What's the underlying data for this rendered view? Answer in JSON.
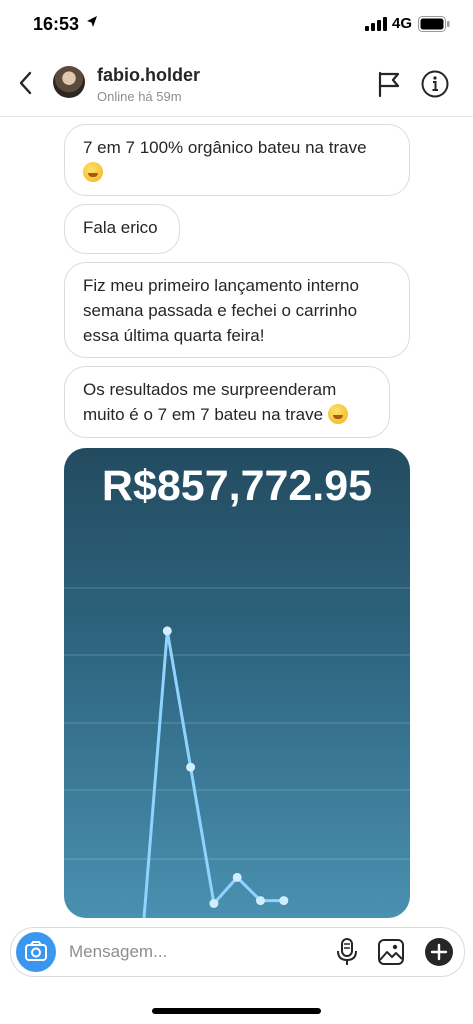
{
  "status_bar": {
    "time": "16:53",
    "network": "4G"
  },
  "header": {
    "username": "fabio.holder",
    "status": "Online há 59m"
  },
  "messages": [
    {
      "text": "7 em 7 100% orgânico bateu na trave"
    },
    {
      "text": "Fala erico"
    },
    {
      "text": "Fiz meu primeiro lançamento interno semana passada e fechei o carrinho essa última quarta feira!"
    },
    {
      "text": "Os resultados me surpreenderam muito é o 7 em 7 bateu na trave"
    }
  ],
  "chart_card": {
    "amount": "R$857,772.95"
  },
  "chart_data": {
    "type": "line",
    "x": [
      1,
      2,
      3,
      4,
      5,
      6,
      7
    ],
    "values": [
      0,
      99,
      52,
      5,
      14,
      6,
      6
    ],
    "ylim": [
      0,
      100
    ],
    "grid": true,
    "color": "#8fd4ff"
  },
  "composer": {
    "placeholder": "Mensagem..."
  },
  "colors": {
    "accent": "#3a97f0",
    "chart_line": "#8fd4ff",
    "bubble_border": "#dbdbdb"
  }
}
